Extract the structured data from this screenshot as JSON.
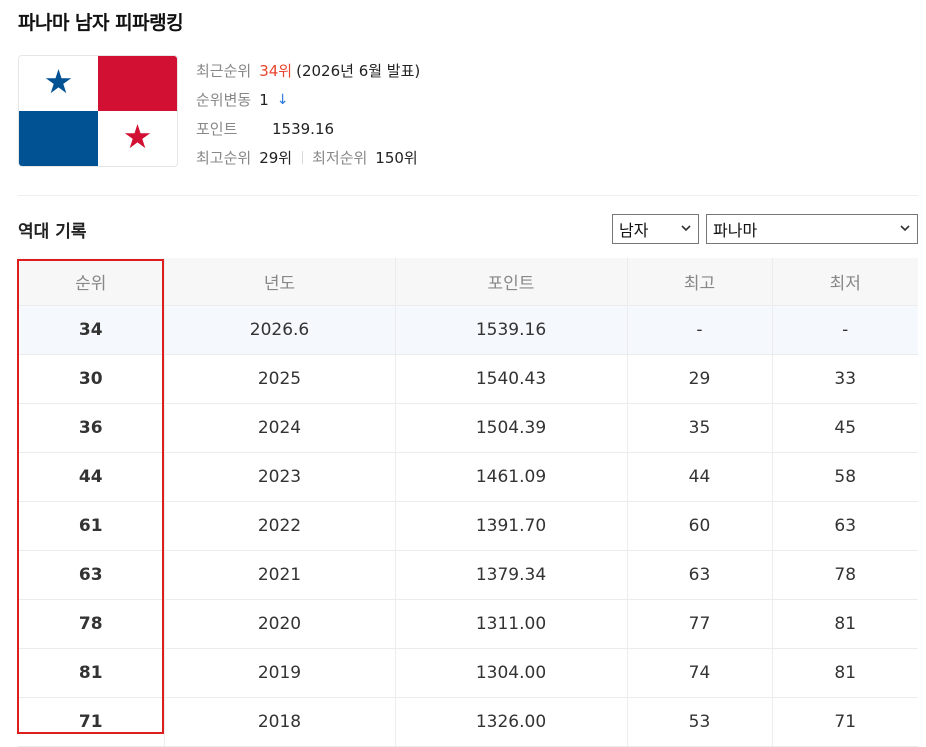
{
  "page": {
    "title": "파나마 남자 피파랭킹"
  },
  "summary": {
    "recent_rank_label": "최근순위",
    "recent_rank_value": "34위",
    "recent_rank_note": "(2026년 6월 발표)",
    "change_label": "순위변동",
    "change_value": "1",
    "change_direction": "down",
    "points_label": "포인트",
    "points_value": "1539.16",
    "best_label": "최고순위",
    "best_value": "29위",
    "worst_label": "최저순위",
    "worst_value": "150위"
  },
  "records": {
    "title": "역대 기록",
    "gender_select": "남자",
    "country_select": "파나마",
    "columns": [
      "순위",
      "년도",
      "포인트",
      "최고",
      "최저"
    ],
    "rows": [
      [
        "34",
        "2026.6",
        "1539.16",
        "-",
        "-"
      ],
      [
        "30",
        "2025",
        "1540.43",
        "29",
        "33"
      ],
      [
        "36",
        "2024",
        "1504.39",
        "35",
        "45"
      ],
      [
        "44",
        "2023",
        "1461.09",
        "44",
        "58"
      ],
      [
        "61",
        "2022",
        "1391.70",
        "60",
        "63"
      ],
      [
        "63",
        "2021",
        "1379.34",
        "63",
        "78"
      ],
      [
        "78",
        "2020",
        "1311.00",
        "77",
        "81"
      ],
      [
        "81",
        "2019",
        "1304.00",
        "74",
        "81"
      ],
      [
        "71",
        "2018",
        "1326.00",
        "53",
        "71"
      ]
    ]
  },
  "colors": {
    "accent_red": "#e8452d",
    "arrow_blue": "#2a7ae4",
    "highlight_border": "#dc1e1e",
    "flag_red": "#d21034",
    "flag_blue": "#005293"
  },
  "icons": {
    "change_arrow": "arrow-down-icon",
    "select_chevron": "chevron-down-icon"
  }
}
